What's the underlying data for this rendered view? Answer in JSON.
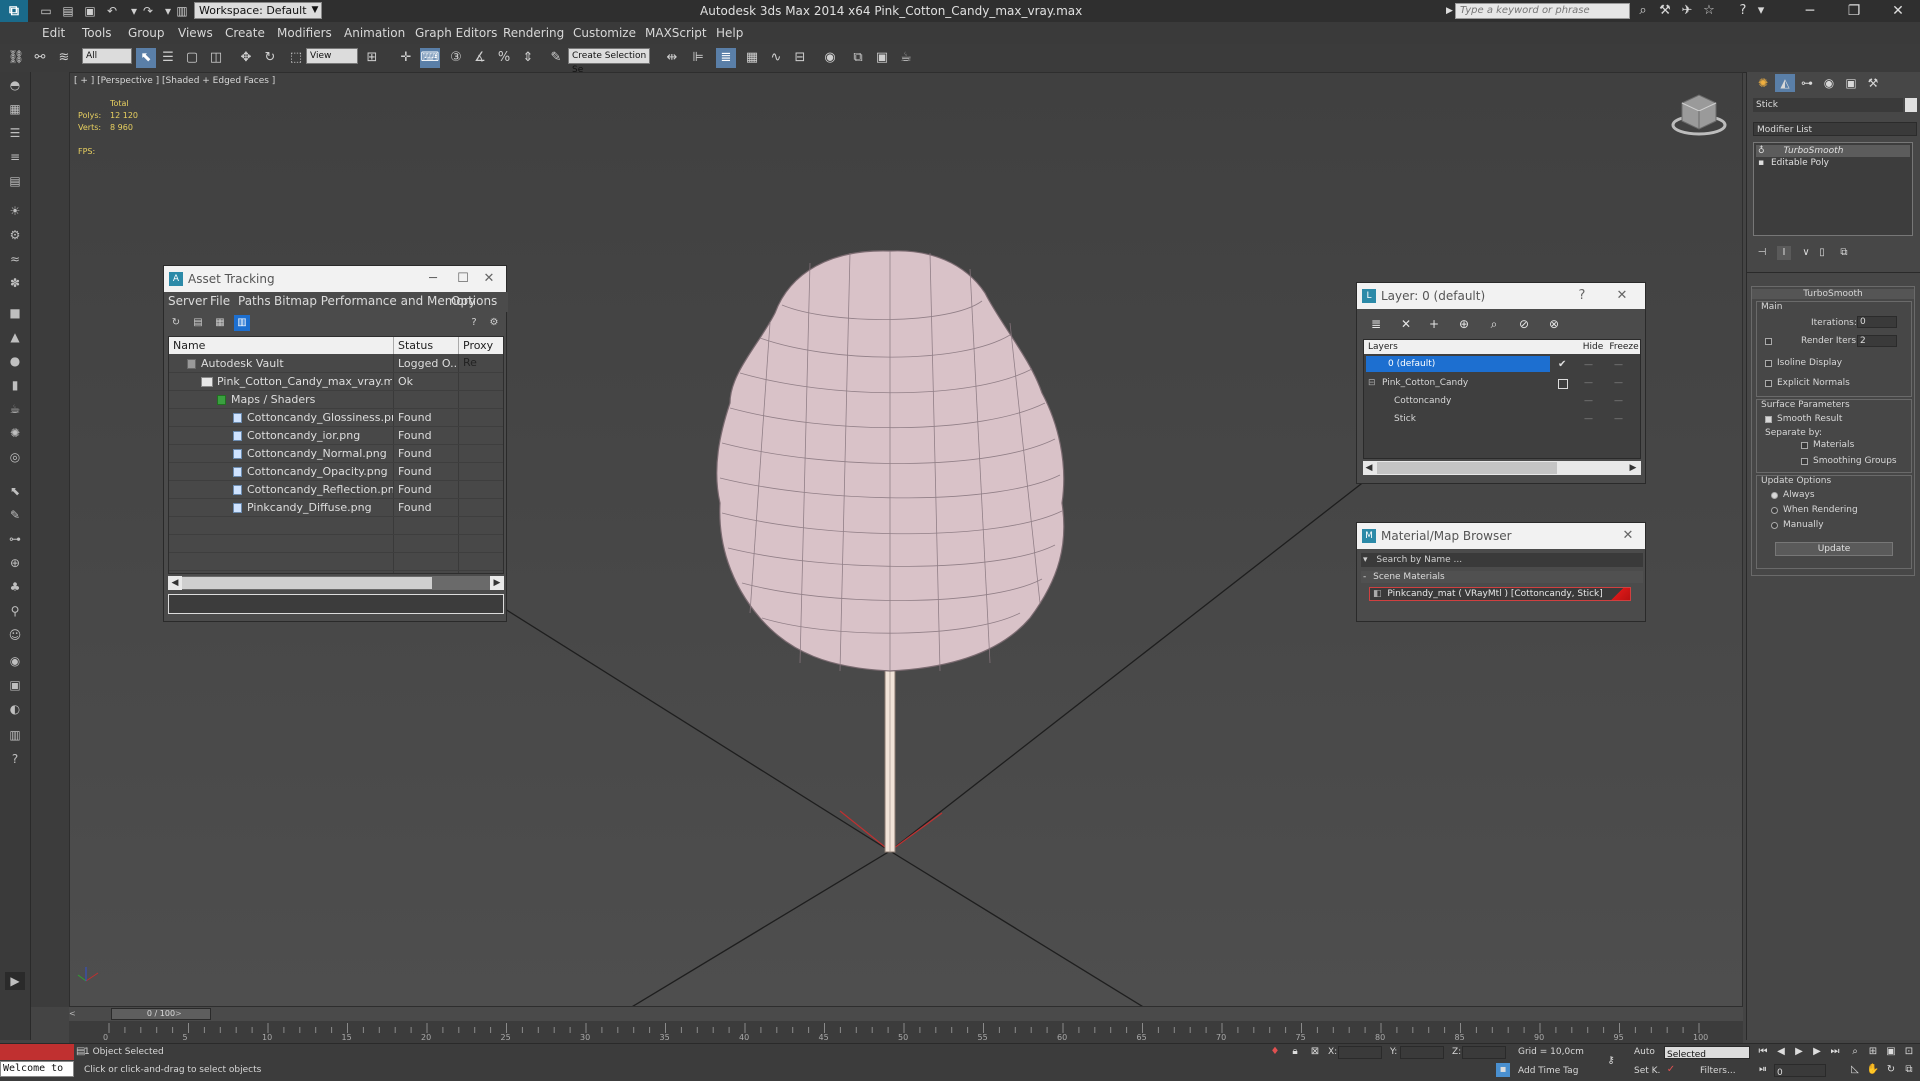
{
  "titlebar": {
    "workspace": "Workspace: Default",
    "window_title": "Autodesk 3ds Max  2014 x64      Pink_Cotton_Candy_max_vray.max",
    "search_placeholder": "Type a keyword or phrase"
  },
  "menubar": [
    "Edit",
    "Tools",
    "Group",
    "Views",
    "Create",
    "Modifiers",
    "Animation",
    "Graph Editors",
    "Rendering",
    "Customize",
    "MAXScript",
    "Help"
  ],
  "toolbar": {
    "filter_value": "All",
    "refcoord_value": "View",
    "named_selection_placeholder": "Create Selection Se"
  },
  "viewport": {
    "label": "[ + ] [Perspective ] [Shaded + Edged Faces ]",
    "stats": {
      "total_label": "Total",
      "polys_label": "Polys:",
      "polys_value": "12 120",
      "verts_label": "Verts:",
      "verts_value": "8 960",
      "fps_label": "FPS:"
    }
  },
  "asset_tracking": {
    "title": "Asset Tracking",
    "menu": [
      "Server",
      "File",
      "Paths",
      "Bitmap Performance and Memory",
      "Options"
    ],
    "columns": [
      "Name",
      "Status",
      "Proxy Re"
    ],
    "rows": [
      {
        "name": "Autodesk Vault",
        "status": "Logged O...",
        "indent": 0
      },
      {
        "name": "Pink_Cotton_Candy_max_vray.max",
        "status": "Ok",
        "indent": 1
      },
      {
        "name": "Maps / Shaders",
        "status": "",
        "indent": 2
      },
      {
        "name": "Cottoncandy_Glossiness.png",
        "status": "Found",
        "indent": 3
      },
      {
        "name": "Cottoncandy_ior.png",
        "status": "Found",
        "indent": 3
      },
      {
        "name": "Cottoncandy_Normal.png",
        "status": "Found",
        "indent": 3
      },
      {
        "name": "Cottoncandy_Opacity.png",
        "status": "Found",
        "indent": 3
      },
      {
        "name": "Cottoncandy_Reflection.png",
        "status": "Found",
        "indent": 3
      },
      {
        "name": "Pinkcandy_Diffuse.png",
        "status": "Found",
        "indent": 3
      }
    ]
  },
  "layer_dialog": {
    "title": "Layer: 0 (default)",
    "help": "?",
    "columns": [
      "Layers",
      "Hide",
      "Freeze"
    ],
    "rows": [
      {
        "name": "0 (default)"
      },
      {
        "name": "Pink_Cotton_Candy"
      },
      {
        "name": "Cottoncandy"
      },
      {
        "name": "Stick"
      }
    ]
  },
  "material_browser": {
    "title": "Material/Map Browser",
    "search_placeholder": "Search by Name ...",
    "group": "Scene Materials",
    "item": "Pinkcandy_mat  ( VRayMtl )  [Cottoncandy, Stick]"
  },
  "command_panel": {
    "object_name": "Stick",
    "modifier_list": "Modifier List",
    "stack": [
      "TurboSmooth",
      "Editable Poly"
    ],
    "turbosmooth": {
      "title": "TurboSmooth",
      "main": "Main",
      "iterations_label": "Iterations:",
      "iterations_value": "0",
      "render_iters_label": "Render Iters:",
      "render_iters_value": "2",
      "isoline": "Isoline Display",
      "explicit_normals": "Explicit Normals",
      "surface_params": "Surface Parameters",
      "smooth_result": "Smooth Result",
      "separate_by": "Separate by:",
      "materials": "Materials",
      "smoothing_groups": "Smoothing Groups",
      "update_options": "Update Options",
      "always": "Always",
      "when_rendering": "When Rendering",
      "manually": "Manually",
      "update_button": "Update"
    }
  },
  "timeline": {
    "frame_display": "0 / 100",
    "ticks": [
      "0",
      "5",
      "10",
      "15",
      "20",
      "25",
      "30",
      "35",
      "40",
      "45",
      "50",
      "55",
      "60",
      "65",
      "70",
      "75",
      "80",
      "85",
      "90",
      "95",
      "100"
    ]
  },
  "statusbar": {
    "welcome": "Welcome to",
    "selection_status": "1 Object Selected",
    "prompt": "Click or click-and-drag to select objects",
    "x_label": "X:",
    "y_label": "Y:",
    "z_label": "Z:",
    "grid": "Grid = 10,0cm",
    "add_time_tag": "Add Time Tag",
    "auto_label": "Auto",
    "selected_value": "Selected",
    "setk_label": "Set K.",
    "filters_label": "Filters...",
    "frame_value": "0"
  }
}
